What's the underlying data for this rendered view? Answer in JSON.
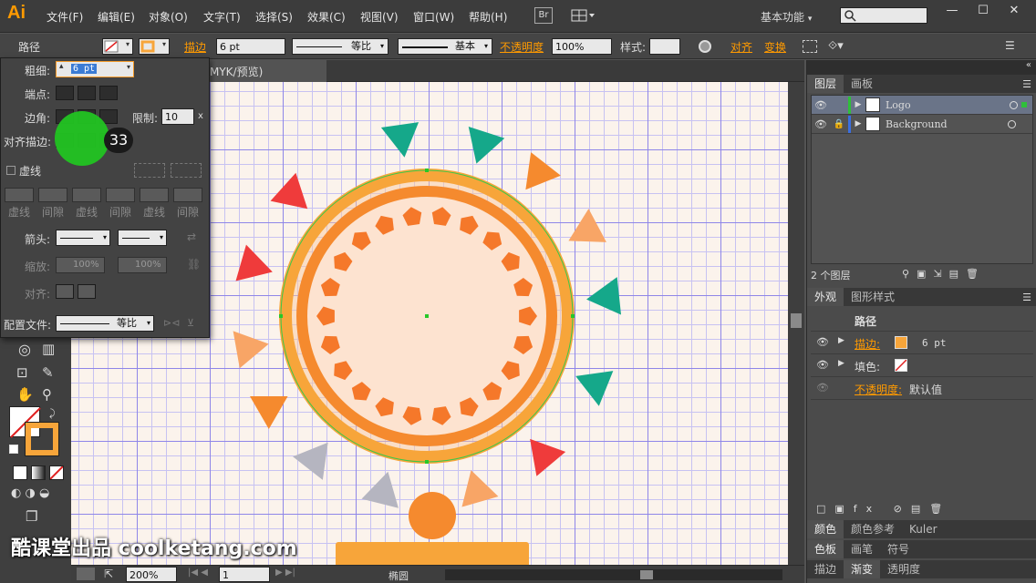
{
  "app": {
    "logo": "Ai",
    "workspace": "基本功能",
    "workspace_arrow": "▾",
    "br_badge": "Br"
  },
  "menu": [
    "文件(F)",
    "编辑(E)",
    "对象(O)",
    "文字(T)",
    "选择(S)",
    "效果(C)",
    "视图(V)",
    "窗口(W)",
    "帮助(H)"
  ],
  "window_controls": {
    "min": "—",
    "max": "☐",
    "close": "✕"
  },
  "control_bar": {
    "selection_label": "路径",
    "stroke_label": "描边",
    "stroke_value": "6 pt",
    "profile_label": "等比",
    "brush_label": "基本",
    "opacity_label": "不透明度",
    "opacity_value": "100%",
    "style_label": "样式:",
    "align_label": "对齐",
    "transform_label": "变换"
  },
  "doc_tab": {
    "title": "MYK/预览)"
  },
  "stroke_panel": {
    "weight_label": "粗细:",
    "weight_value": "6 pt",
    "cap_label": "端点:",
    "corner_label": "边角:",
    "limit_label": "限制:",
    "limit_value": "10",
    "limit_x": "x",
    "align_label": "对齐描边:",
    "dashed_label": "虚线",
    "dash_labels": [
      "虚线",
      "间隙",
      "虚线",
      "间隙",
      "虚线",
      "间隙"
    ],
    "arrow_label": "箭头:",
    "scale_label": "缩放:",
    "scale_value_1": "100%",
    "scale_value_2": "100%",
    "align2_label": "对齐:",
    "profile_label": "配置文件:",
    "profile_value": "等比"
  },
  "overlay": {
    "step_number": "33"
  },
  "status_bar": {
    "zoom": "200%",
    "page": "1",
    "tool": "椭圆"
  },
  "layers_panel": {
    "tabs": [
      "图层",
      "画板"
    ],
    "layers": [
      {
        "name": "Logo",
        "color": "#2fbf3a",
        "selected": true
      },
      {
        "name": "Background",
        "color": "#3b6fe0",
        "selected": false,
        "locked": true
      }
    ],
    "count": "2 个图层"
  },
  "appearance_panel": {
    "tabs": [
      "外观",
      "图形样式"
    ],
    "object": "路径",
    "stroke_label": "描边:",
    "stroke_value": "6 pt",
    "fill_label": "填色:",
    "opacity_label": "不透明度:",
    "opacity_value": "默认值",
    "stroke_color": "#f7a53a"
  },
  "bottom_tabs": [
    [
      "颜色",
      "颜色参考",
      "Kuler"
    ],
    [
      "色板",
      "画笔",
      "符号"
    ],
    [
      "描边",
      "渐变",
      "透明度"
    ]
  ],
  "watermark": "酷课堂出品 coolketang.com",
  "colors": {
    "accent": "#ff9a00",
    "teal": "#15a88a",
    "red": "#ef3b3b",
    "orange": "#f58a2e",
    "grey": "#b5b5c0"
  }
}
